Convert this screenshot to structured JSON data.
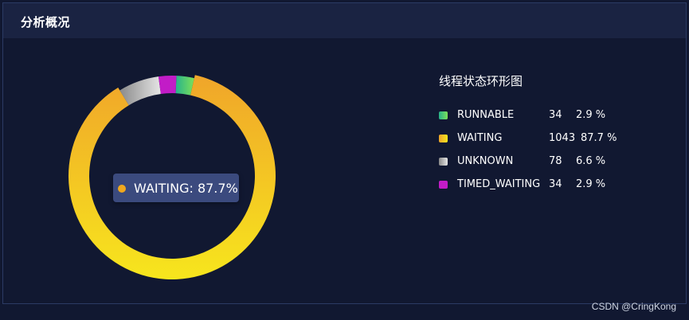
{
  "panel": {
    "title": "分析概况"
  },
  "tooltip": {
    "text": "WAITING: 87.7%",
    "color": "#f0a81d"
  },
  "watermark": "CSDN @CringKong",
  "chart_data": {
    "type": "pie",
    "variant": "donut",
    "title": "线程状态环形图",
    "legend_position": "right",
    "series": [
      {
        "name": "RUNNABLE",
        "value": 34,
        "percent": "2.9 %",
        "colors": [
          "#28b38a",
          "#7ce05a"
        ]
      },
      {
        "name": "WAITING",
        "value": 1043,
        "percent": "87.7 %",
        "colors": [
          "#f0a52a",
          "#f7e61d"
        ]
      },
      {
        "name": "UNKNOWN",
        "value": 78,
        "percent": "6.6 %",
        "colors": [
          "#8a8a8a",
          "#e6e6e6"
        ]
      },
      {
        "name": "TIMED_WAITING",
        "value": 34,
        "percent": "2.9 %",
        "colors": [
          "#c21cc7",
          "#c21cc7"
        ]
      }
    ],
    "highlighted": "WAITING"
  }
}
